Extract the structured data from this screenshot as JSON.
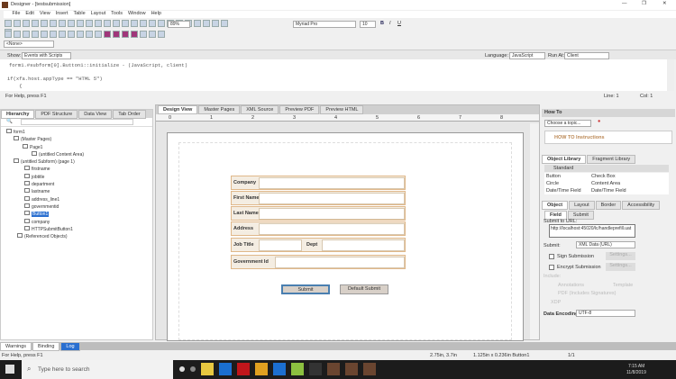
{
  "window": {
    "title": "Designer - [testsubmission]"
  },
  "menu": [
    "File",
    "Edit",
    "View",
    "Insert",
    "Table",
    "Layout",
    "Tools",
    "Window",
    "Help"
  ],
  "toolbar": {
    "zoom": "89%",
    "font": "Myriad Pro",
    "size": "10",
    "style_select": "<None>",
    "bold": "B",
    "italic": "I",
    "underline": "U"
  },
  "script": {
    "show_label": "Show:",
    "show_value": "Events with Scripts",
    "language_label": "Language:",
    "language": "JavaScript",
    "run_at_label": "Run At:",
    "run_at": "Client",
    "line1": "form1.#subform[0].Button1::initialize - (JavaScript, client)",
    "line2": "if(xfa.host.appType == \"HTML 5\")",
    "line3": "    {",
    "status": "For Help, press F1",
    "line": "Line: 1",
    "col": "Col: 1"
  },
  "left_panel": {
    "tabs": [
      "Hierarchy",
      "PDF Structure",
      "Data View",
      "Tab Order"
    ],
    "tree": [
      "form1",
      "(Master Pages)",
      "Page1",
      "(untitled Content Area)",
      "(untitled Subform) (page 1)",
      "firstname",
      "jobtitle",
      "department",
      "lastname",
      "address_line1",
      "governmentid",
      "Button1",
      "company",
      "HTTPSubmitButton1",
      "(Referenced Objects)"
    ],
    "selected": "Button1"
  },
  "center": {
    "tabs": [
      "Design View",
      "Master Pages",
      "XML Source",
      "Preview PDF",
      "Preview HTML"
    ],
    "ruler": [
      "0",
      "1",
      "2",
      "3",
      "4",
      "5",
      "6",
      "7",
      "8"
    ],
    "fields": [
      "Company",
      "First Name",
      "Last Name",
      "Address"
    ],
    "job_title": "Job Title",
    "dept": "Dept",
    "government_id": "Government Id",
    "submit": "Submit",
    "default_submit": "Default Submit"
  },
  "right_panel": {
    "howto_title": "How To",
    "topic_placeholder": "Choose a topic...",
    "howto_link": "HOW TO Instructions",
    "library_tabs": [
      "Object Library",
      "Fragment Library"
    ],
    "library_group": "Standard",
    "library_items": [
      "Button",
      "Check Box",
      "Circle",
      "Content Area",
      "Date/Time Field",
      "Date/Time Field"
    ],
    "object_tabs": [
      "Object",
      "Layout",
      "Border",
      "Accessibility"
    ],
    "sub_tabs": [
      "Field",
      "Submit"
    ],
    "submit_url_label": "Submit to URL:",
    "submit_url": "http://localhost:45020/lc/handleprefill.uat",
    "submit_label": "Submit:",
    "submit_value": "XML Data (URL)",
    "sign": "Sign Submission",
    "encrypt": "Encrypt Submission",
    "settings": "Settings...",
    "include": "Include:",
    "opt1": "Annotations",
    "opt2": "Template",
    "opt3": "PDF (Includes Signatures)",
    "opt4": "XDP",
    "data_encoding_label": "Data Encoding:",
    "data_encoding": "UTF-8"
  },
  "bottom": {
    "tabs": [
      "Warnings",
      "Binding",
      "Log"
    ],
    "status": "For Help, press F1",
    "pos": "2.75in, 3.7in",
    "size": "1.125in x 0.236in Button1",
    "page": "1/1"
  },
  "taskbar": {
    "search": "Type here to search",
    "time": "7:15 AM",
    "date": "11/8/2019"
  }
}
